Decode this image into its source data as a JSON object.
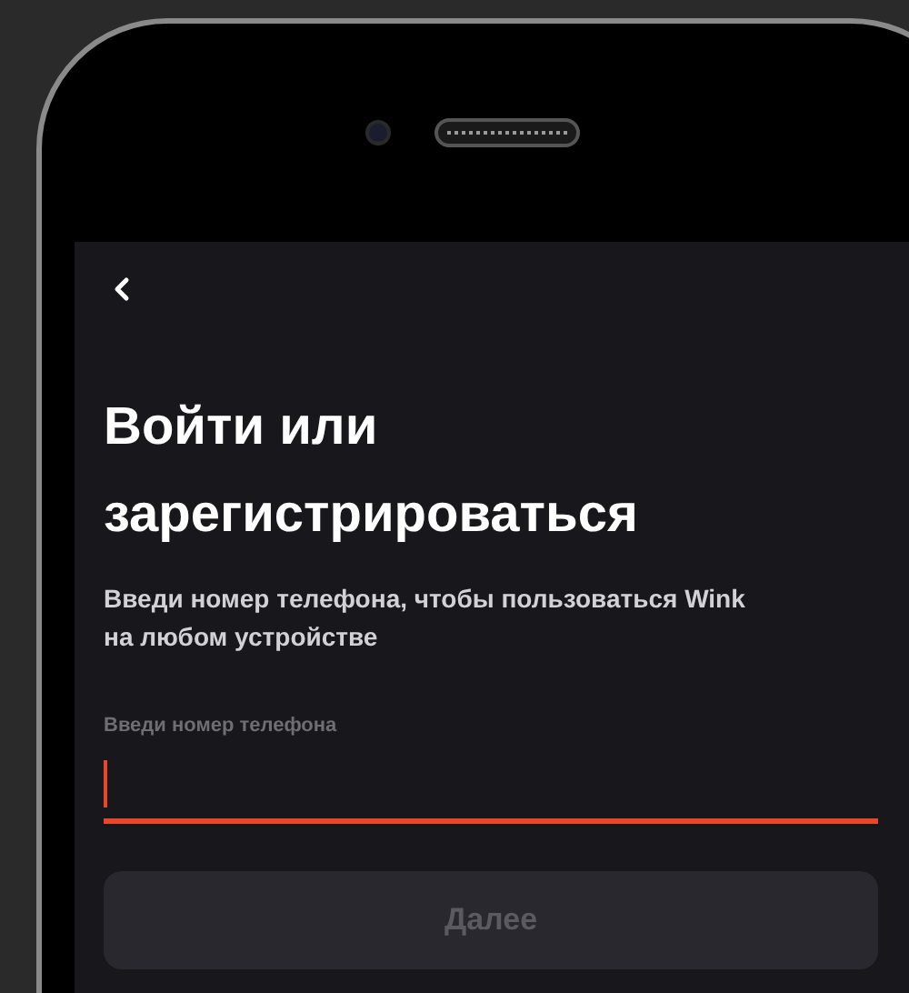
{
  "title": "Войти или зарегистрироваться",
  "subtitle": "Введи номер телефона, чтобы пользоваться Wink на любом устройстве",
  "phone_field": {
    "label": "Введи номер телефона",
    "focused": true
  },
  "next_button": {
    "label": "Далее",
    "disabled": true
  }
}
